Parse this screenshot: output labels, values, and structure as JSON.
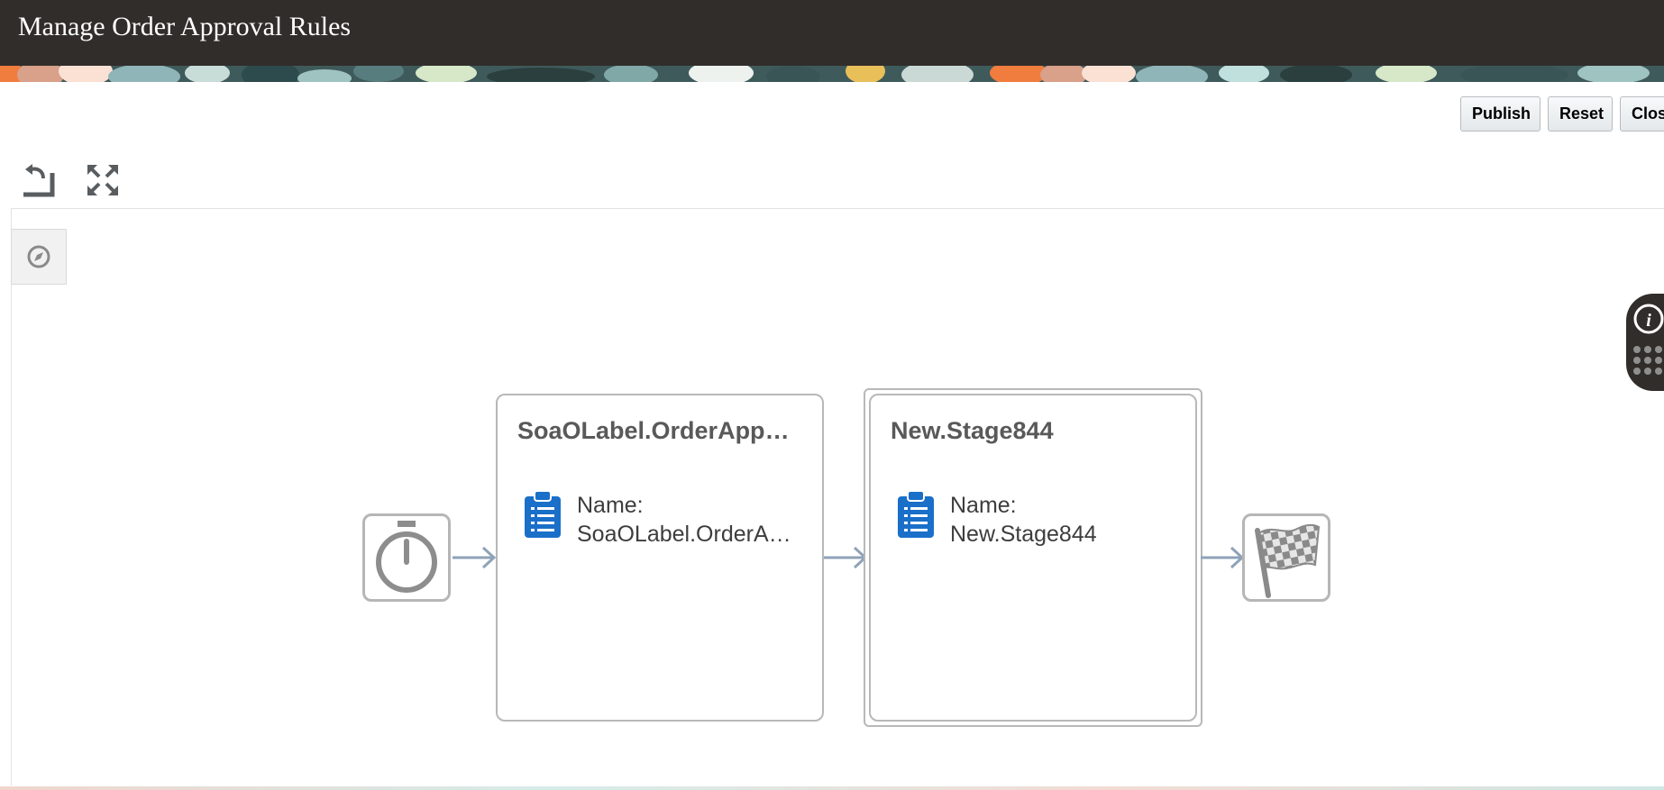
{
  "header": {
    "title": "Manage Order Approval Rules"
  },
  "toolbar": {
    "publish_label": "Publish",
    "reset_label": "Reset",
    "close_label": "Close"
  },
  "diagram_tools": {
    "items": [
      {
        "icon": "undo-layout-icon"
      },
      {
        "icon": "expand-icon"
      }
    ]
  },
  "navigator": {
    "icon": "compass-icon"
  },
  "side_panel": {
    "icons": [
      "info-icon",
      "grid-dots-icon"
    ]
  },
  "flow": {
    "start_icon": "stopwatch-icon",
    "end_icon": "checkered-flag-icon",
    "stages": [
      {
        "title": "SoaOLabel.OrderApprovalStage",
        "item_label": "Name:",
        "item_value": "SoaOLabel.OrderApprovalStage",
        "item_icon": "clipboard-icon",
        "selected": false
      },
      {
        "title": "New.Stage844",
        "item_label": "Name:",
        "item_value": "New.Stage844",
        "item_icon": "clipboard-icon",
        "selected": true
      }
    ]
  },
  "colors": {
    "header_bg": "#312d2a",
    "connector": "#8fa3b8",
    "clipboard_blue": "#1a6fc9",
    "node_border": "#b6b6b6"
  }
}
